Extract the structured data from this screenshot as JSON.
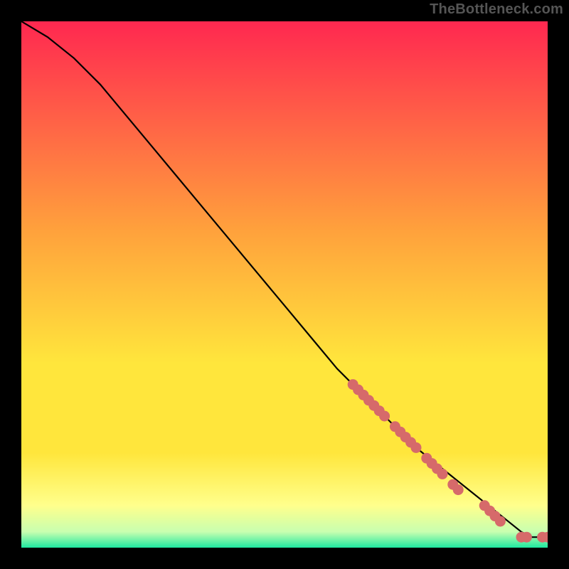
{
  "watermark": "TheBottleneck.com",
  "colors": {
    "background": "#000000",
    "gradient_top": "#ff2850",
    "gradient_mid_orange": "#ffa23c",
    "gradient_mid_yellow": "#ffe63c",
    "gradient_low_yellow": "#ffff8c",
    "gradient_bottom": "#1ee8a0",
    "curve": "#000000",
    "dot_fill": "#d66a6a",
    "dot_stroke": "#c05858"
  },
  "chart_data": {
    "type": "line",
    "title": "",
    "xlabel": "",
    "ylabel": "",
    "xlim": [
      0,
      100
    ],
    "ylim": [
      0,
      100
    ],
    "curve": {
      "x": [
        0,
        5,
        10,
        15,
        20,
        25,
        30,
        35,
        40,
        45,
        50,
        55,
        60,
        65,
        70,
        75,
        80,
        85,
        90,
        95,
        97,
        99,
        100
      ],
      "y": [
        100,
        97,
        93,
        88,
        82,
        76,
        70,
        64,
        58,
        52,
        46,
        40,
        34,
        29,
        24,
        19,
        15,
        11,
        7,
        3,
        2,
        2,
        2
      ]
    },
    "dots": [
      {
        "x": 63,
        "y": 31
      },
      {
        "x": 64,
        "y": 30
      },
      {
        "x": 65,
        "y": 29
      },
      {
        "x": 66,
        "y": 28
      },
      {
        "x": 67,
        "y": 27
      },
      {
        "x": 68,
        "y": 26
      },
      {
        "x": 69,
        "y": 25
      },
      {
        "x": 71,
        "y": 23
      },
      {
        "x": 72,
        "y": 22
      },
      {
        "x": 73,
        "y": 21
      },
      {
        "x": 74,
        "y": 20
      },
      {
        "x": 75,
        "y": 19
      },
      {
        "x": 77,
        "y": 17
      },
      {
        "x": 78,
        "y": 16
      },
      {
        "x": 79,
        "y": 15
      },
      {
        "x": 80,
        "y": 14
      },
      {
        "x": 82,
        "y": 12
      },
      {
        "x": 83,
        "y": 11
      },
      {
        "x": 88,
        "y": 8
      },
      {
        "x": 89,
        "y": 7
      },
      {
        "x": 90,
        "y": 6
      },
      {
        "x": 91,
        "y": 5
      },
      {
        "x": 95,
        "y": 2
      },
      {
        "x": 96,
        "y": 2
      },
      {
        "x": 99,
        "y": 2
      },
      {
        "x": 100,
        "y": 2
      }
    ]
  }
}
